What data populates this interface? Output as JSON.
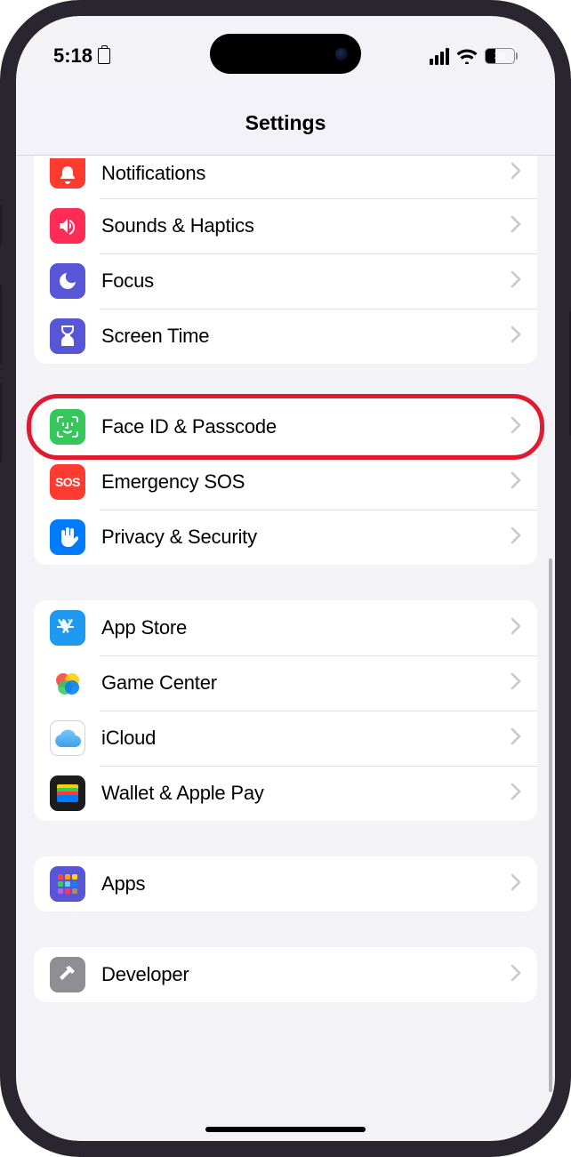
{
  "status": {
    "time": "5:18",
    "battery_percent": "35"
  },
  "header": {
    "title": "Settings"
  },
  "groups": [
    {
      "id": "g1",
      "first": true,
      "rows": [
        {
          "id": "notifications",
          "label": "Notifications",
          "icon": "bell",
          "color": "#ff3b30",
          "highlight": false,
          "cut_top": true
        },
        {
          "id": "sounds-haptics",
          "label": "Sounds & Haptics",
          "icon": "speaker",
          "color": "#ff2d55",
          "highlight": false
        },
        {
          "id": "focus",
          "label": "Focus",
          "icon": "moon",
          "color": "#5856d6",
          "highlight": false
        },
        {
          "id": "screen-time",
          "label": "Screen Time",
          "icon": "hourglass",
          "color": "#5856d6",
          "highlight": false
        }
      ]
    },
    {
      "id": "g2",
      "rows": [
        {
          "id": "face-id-passcode",
          "label": "Face ID & Passcode",
          "icon": "faceid",
          "color": "#34c759",
          "highlight": true
        },
        {
          "id": "emergency-sos",
          "label": "Emergency SOS",
          "icon": "sos",
          "color": "#ff3b30",
          "highlight": false
        },
        {
          "id": "privacy-security",
          "label": "Privacy & Security",
          "icon": "hand",
          "color": "#007aff",
          "highlight": false
        }
      ]
    },
    {
      "id": "g3",
      "rows": [
        {
          "id": "app-store",
          "label": "App Store",
          "icon": "appstore",
          "color": "#1e9bf0",
          "highlight": false
        },
        {
          "id": "game-center",
          "label": "Game Center",
          "icon": "gamecenter",
          "color": "gradient",
          "highlight": false
        },
        {
          "id": "icloud",
          "label": "iCloud",
          "icon": "icloud",
          "color": "#ffffff",
          "highlight": false
        },
        {
          "id": "wallet-apple-pay",
          "label": "Wallet & Apple Pay",
          "icon": "wallet",
          "color": "#000000",
          "highlight": false
        }
      ]
    },
    {
      "id": "g4",
      "rows": [
        {
          "id": "apps",
          "label": "Apps",
          "icon": "apps",
          "color": "#5856d6",
          "highlight": false
        }
      ]
    },
    {
      "id": "g5",
      "rows": [
        {
          "id": "developer",
          "label": "Developer",
          "icon": "hammer",
          "color": "#8e8e93",
          "highlight": false
        }
      ]
    }
  ]
}
